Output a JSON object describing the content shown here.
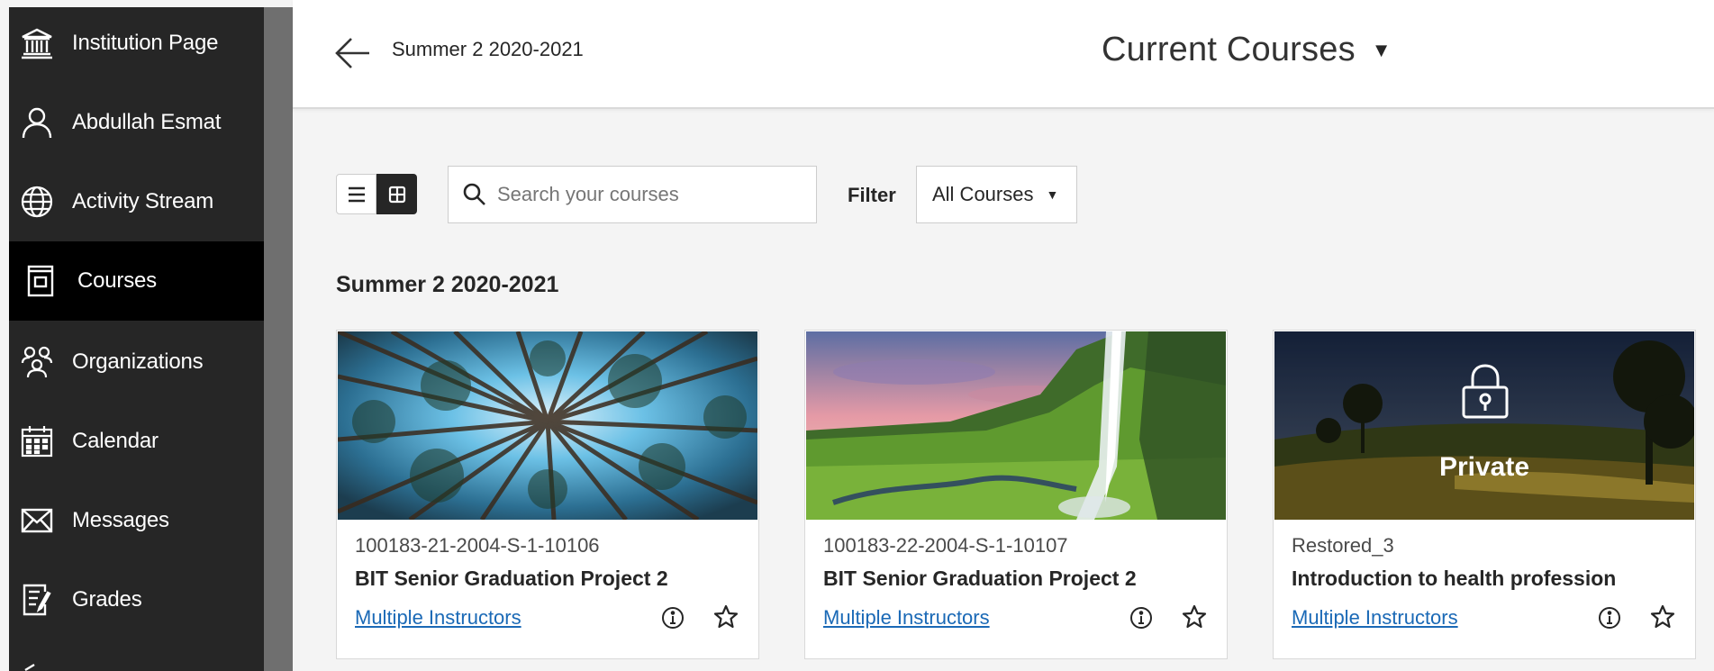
{
  "sidebar": {
    "items": [
      {
        "label": "Institution Page",
        "icon": "institution-icon"
      },
      {
        "label": "Abdullah Esmat",
        "icon": "user-icon"
      },
      {
        "label": "Activity Stream",
        "icon": "globe-icon"
      },
      {
        "label": "Courses",
        "icon": "courses-icon",
        "active": true
      },
      {
        "label": "Organizations",
        "icon": "organizations-icon"
      },
      {
        "label": "Calendar",
        "icon": "calendar-icon"
      },
      {
        "label": "Messages",
        "icon": "envelope-icon"
      },
      {
        "label": "Grades",
        "icon": "grades-icon"
      }
    ]
  },
  "header": {
    "breadcrumb": "Summer 2 2020-2021",
    "title": "Current Courses"
  },
  "toolbar": {
    "search_placeholder": "Search your courses",
    "filter_label": "Filter",
    "filter_value": "All Courses"
  },
  "term": {
    "title": "Summer 2 2020-2021"
  },
  "courses": [
    {
      "id": "100183-21-2004-S-1-10106",
      "name": "BIT Senior Graduation Project 2",
      "instructors": "Multiple Instructors",
      "image": "forest-canopy"
    },
    {
      "id": "100183-22-2004-S-1-10107",
      "name": "BIT Senior Graduation Project 2",
      "instructors": "Multiple Instructors",
      "image": "waterfall-landscape"
    },
    {
      "id": "Restored_3",
      "name": "Introduction to health profession",
      "instructors": "Multiple Instructors",
      "image": "sunset-meadow",
      "private_label": "Private"
    }
  ],
  "colors": {
    "sidebar_bg": "#262626",
    "sidebar_active": "#000000",
    "link": "#1a69b6",
    "page_bg": "#f4f4f4"
  }
}
